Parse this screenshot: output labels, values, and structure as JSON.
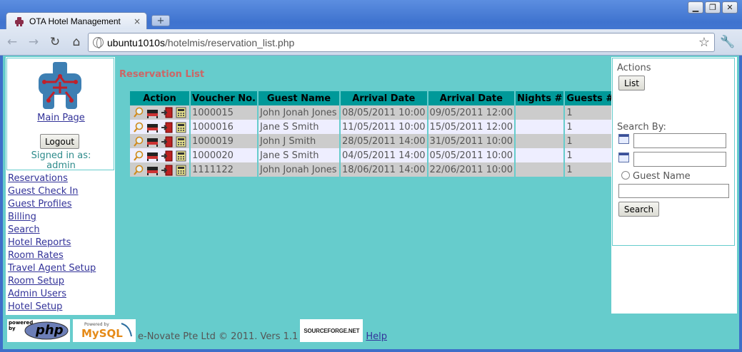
{
  "browser": {
    "tab_title": "OTA Hotel Management",
    "tab_close": "×",
    "new_tab": "+",
    "url_host": "ubuntu1010s",
    "url_path": "/hotelmis/reservation_list.php",
    "window_buttons": [
      "▁",
      "❐",
      "✕"
    ]
  },
  "sidebar": {
    "main_page": "Main Page",
    "logout": "Logout",
    "signed_in_label": "Signed in as:",
    "signed_in_user": "admin",
    "menu": [
      "Reservations",
      "Guest Check In",
      "Guest Profiles",
      "Billing",
      "Search",
      "Hotel Reports",
      "Room Rates",
      "Travel Agent Setup",
      "Room Setup",
      "Admin Users",
      "Hotel Setup"
    ]
  },
  "main": {
    "title": "Reservation List",
    "columns": [
      "Action",
      "Voucher No.",
      "Guest Name",
      "Arrival Date",
      "Arrival Date",
      "Nights #",
      "Guests #"
    ],
    "rows": [
      {
        "voucher": "1000015",
        "guest": "John Jonah Jones",
        "arrival": "08/05/2011 10:00",
        "departure": "09/05/2011 12:00",
        "nights": "",
        "guests": "1"
      },
      {
        "voucher": "1000016",
        "guest": "Jane S Smith",
        "arrival": "11/05/2011 10:00",
        "departure": "15/05/2011 12:00",
        "nights": "",
        "guests": "1"
      },
      {
        "voucher": "1000019",
        "guest": "John J Smith",
        "arrival": "28/05/2011 14:00",
        "departure": "31/05/2011 10:00",
        "nights": "",
        "guests": "1"
      },
      {
        "voucher": "1000020",
        "guest": "Jane S Smith",
        "arrival": "04/05/2011 14:00",
        "departure": "05/05/2011 10:00",
        "nights": "",
        "guests": "1"
      },
      {
        "voucher": "1111122",
        "guest": "John Jonah Jones",
        "arrival": "18/06/2011 14:00",
        "departure": "22/06/2011 10:00",
        "nights": "",
        "guests": "1"
      }
    ]
  },
  "actions_panel": {
    "heading": "Actions",
    "list_button": "List",
    "search_by": "Search By:",
    "guest_name_option": "Guest Name",
    "search_button": "Search"
  },
  "footer": {
    "php_badge_small": "powered by",
    "php_badge_big": "php",
    "mysql_badge_small": "Powered by",
    "mysql_badge_big": "MySQL",
    "copyright": "e-Novate Pte Ltd © 2011. Vers 1.1",
    "sourceforge": "SOURCEFORGE.NET",
    "help": "Help"
  },
  "colors": {
    "page_bg": "#66cccc",
    "header_bg": "#009999",
    "title": "#cc6666",
    "link": "#333399"
  }
}
